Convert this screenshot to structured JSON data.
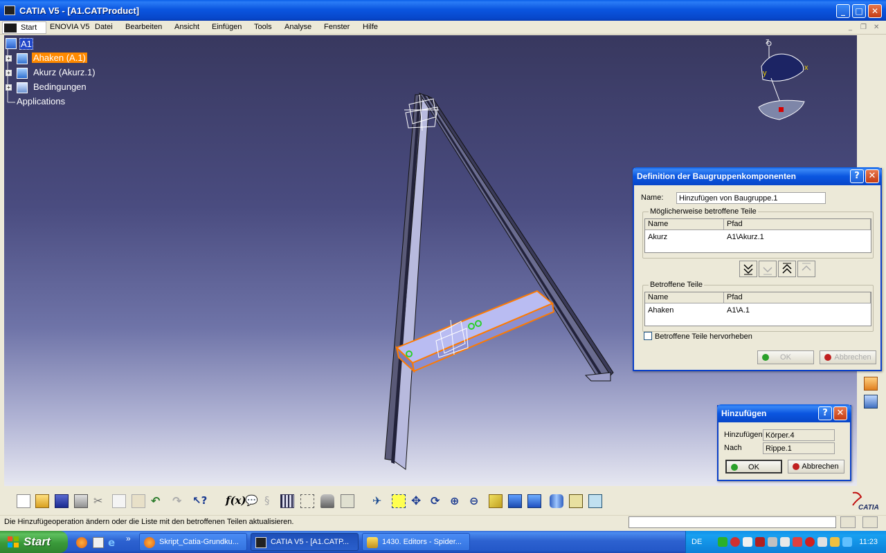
{
  "window": {
    "title": "CATIA V5 - [A1.CATProduct]"
  },
  "menu": {
    "start": "Start",
    "items": [
      "ENOVIA V5",
      "Datei",
      "Bearbeiten",
      "Ansicht",
      "Einfügen",
      "Tools",
      "Analyse",
      "Fenster",
      "Hilfe"
    ]
  },
  "tree": {
    "root": "A1",
    "items": [
      "Ahaken (A.1)",
      "Akurz (Akurz.1)",
      "Bedingungen",
      "Applications"
    ]
  },
  "compass": {
    "z": "z",
    "x": "x",
    "y": "y"
  },
  "assembly_dialog": {
    "title": "Definition der Baugruppenkomponenten",
    "help": "?",
    "close": "✕",
    "name_label": "Name:",
    "name_value": "Hinzufügen von Baugruppe.1",
    "possibly_group": "Möglicherweise betroffene Teile",
    "affected_group": "Betroffene Teile",
    "col_name": "Name",
    "col_path": "Pfad",
    "possible_rows": [
      {
        "name": "Akurz",
        "path": "A1\\Akurz.1"
      }
    ],
    "affected_rows": [
      {
        "name": "Ahaken",
        "path": "A1\\A.1"
      }
    ],
    "highlight_label": "Betroffene Teile hervorheben",
    "ok": "OK",
    "cancel": "Abbrechen"
  },
  "add_dialog": {
    "title": "Hinzufügen",
    "help": "?",
    "close": "✕",
    "add_label": "Hinzufügen",
    "add_value": "Körper.4",
    "after_label": "Nach",
    "after_value": "Rippe.1",
    "ok": "OK",
    "cancel": "Abbrechen"
  },
  "status": {
    "message": "Die Hinzufügeoperation ändern oder die Liste mit den betroffenen Teilen aktualisieren."
  },
  "taskbar": {
    "start": "Start",
    "chevron": "»",
    "tasks": [
      "Skript_Catia-Grundku...",
      "CATIA V5 - [A1.CATP...",
      "1430. Editors - Spider..."
    ],
    "lang": "DE",
    "clock": "11:23"
  },
  "brand": "CATIA",
  "colors": {
    "selection": "#ff8a00",
    "xp_blue": "#0b56e0",
    "start_green": "#3a993a"
  }
}
